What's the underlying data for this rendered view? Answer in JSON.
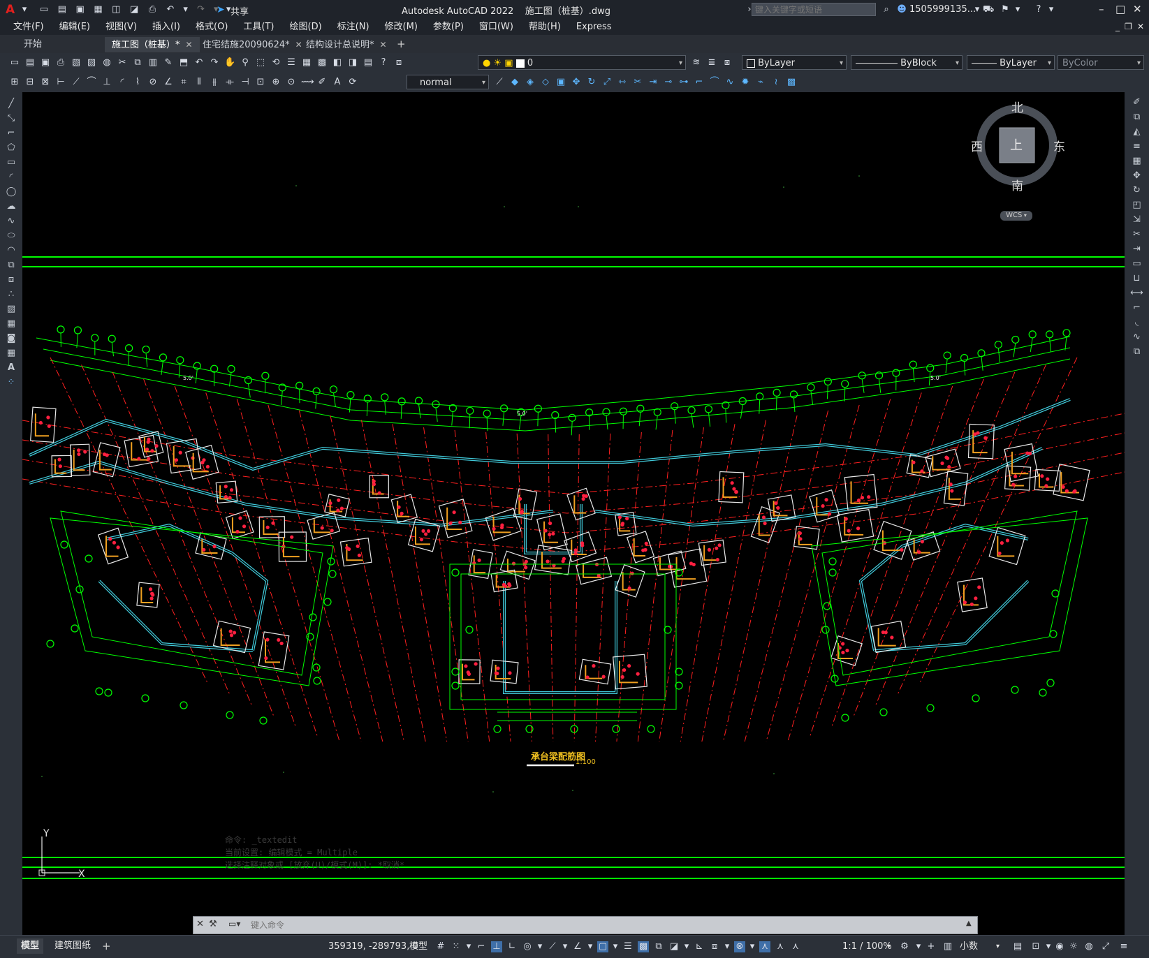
{
  "app": {
    "title": "Autodesk AutoCAD 2022    施工图（桩基）.dwg",
    "logo": "A",
    "share": "共享",
    "search_placeholder": "键入关键字或短语",
    "user": "1505999135...",
    "window_controls": [
      "–",
      "□",
      "✕"
    ]
  },
  "menu": [
    "文件(F)",
    "编辑(E)",
    "视图(V)",
    "插入(I)",
    "格式(O)",
    "工具(T)",
    "绘图(D)",
    "标注(N)",
    "修改(M)",
    "参数(P)",
    "窗口(W)",
    "帮助(H)",
    "Express"
  ],
  "tabs": [
    {
      "label": "开始",
      "closable": false
    },
    {
      "label": "施工图（桩基）*",
      "closable": true,
      "active": true
    },
    {
      "label": "住宅结施20090624*",
      "closable": true
    },
    {
      "label": "结构设计总说明*",
      "closable": true
    }
  ],
  "toolbar": {
    "layer_value": "0",
    "color_value": "ByLayer",
    "linetype_value": "ByBlock",
    "lineweight_value": "ByLayer",
    "plotstyle_value": "ByColor",
    "textstyle_value": "normal"
  },
  "viewcube": {
    "north": "北",
    "south": "南",
    "east": "东",
    "west": "西",
    "top": "上",
    "wcs": "WCS"
  },
  "drawing": {
    "title": "承台梁配筋图",
    "scale": "1:100",
    "grid_label": "H",
    "dim_label": "5.0'"
  },
  "ucs": {
    "x": "X",
    "y": "Y"
  },
  "command": {
    "history": [
      "命令: _textedit",
      "当前设置: 编辑模式 = Multiple",
      "选择注释对象或 [放弃(U)/模式(M)]: *取消*"
    ],
    "placeholder": "键入命令"
  },
  "layout_tabs": [
    "模型",
    "建筑图纸"
  ],
  "status": {
    "coords": "359319, -289793, 0",
    "space": "模型",
    "scale": "1:1 / 100%",
    "units": "小数"
  },
  "colors": {
    "canvas": "#000000",
    "grid_green": "#00ff00",
    "axis_red": "#ff2020",
    "beam_cyan": "#40c8d8",
    "rebar_orange": "#f0a020",
    "pile_red": "#ff2040",
    "title_yellow": "#f0c020"
  }
}
